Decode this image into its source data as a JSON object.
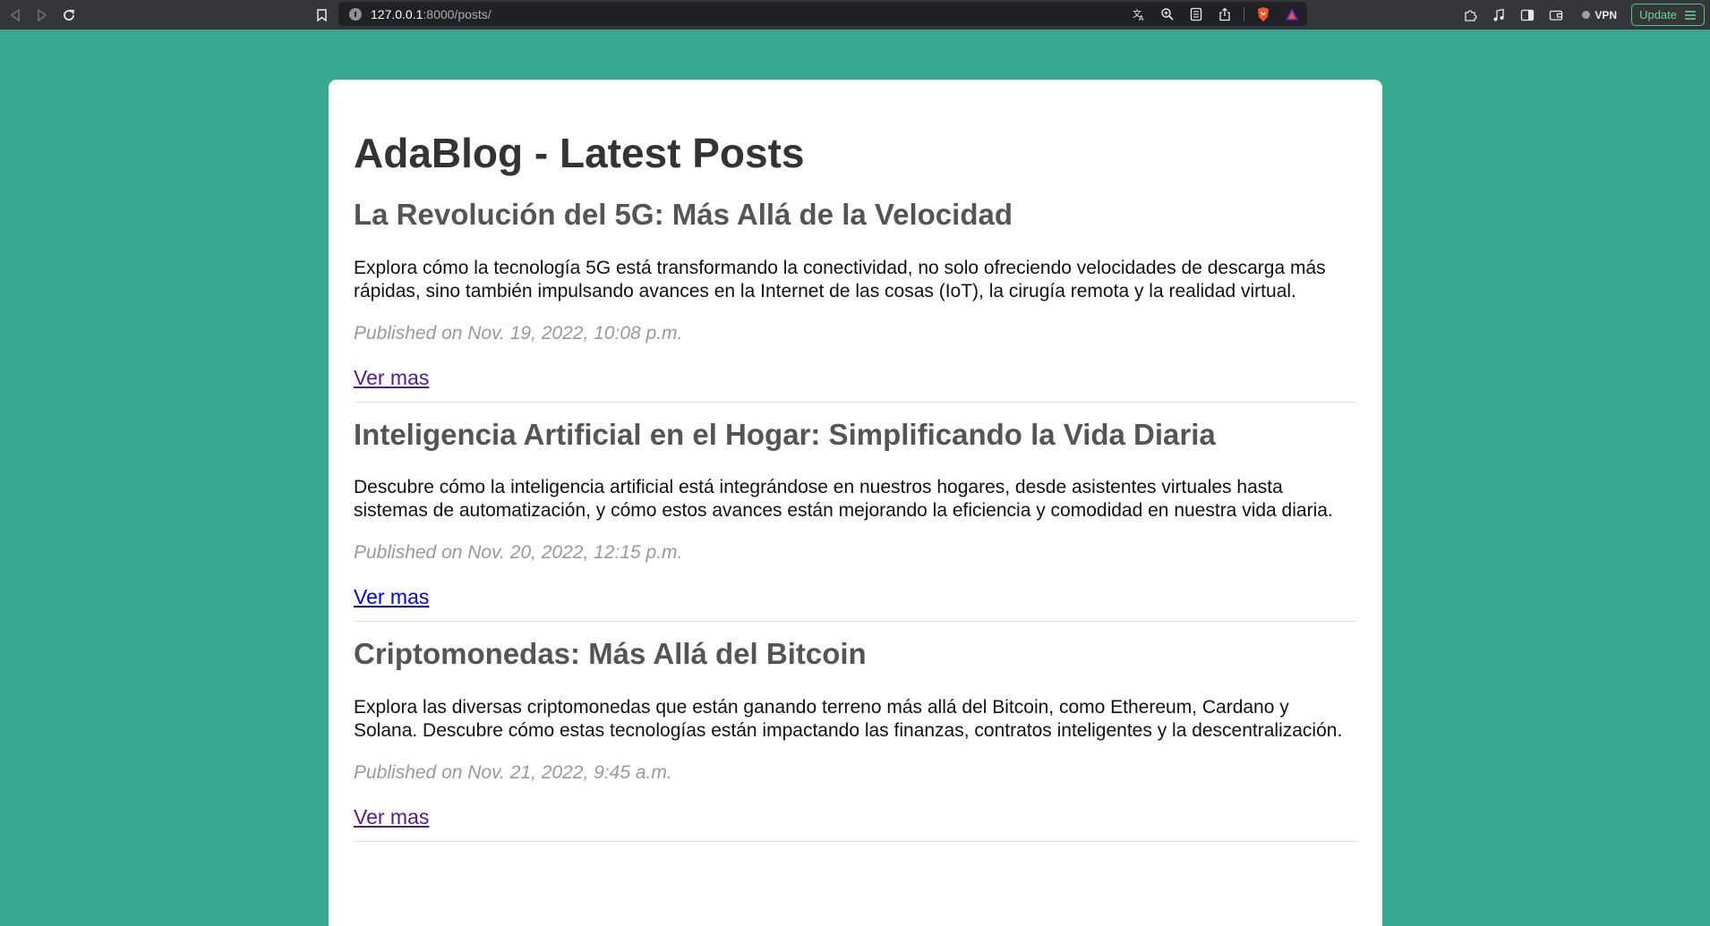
{
  "browser": {
    "url_host": "127.0.0.1",
    "url_rest": ":8000/posts/",
    "vpn_label": "VPN",
    "update_label": "Update",
    "accent": "#37a990"
  },
  "page": {
    "title": "AdaBlog - Latest Posts",
    "posts": [
      {
        "title": "La Revolución del 5G: Más Allá de la Velocidad",
        "excerpt": "Explora cómo la tecnología 5G está transformando la conectividad, no solo ofreciendo velocidades de descarga más rápidas, sino también impulsando avances en la Internet de las cosas (IoT), la cirugía remota y la realidad virtual.",
        "date": "Published on Nov. 19, 2022, 10:08 p.m.",
        "link": "Ver mas"
      },
      {
        "title": "Inteligencia Artificial en el Hogar: Simplificando la Vida Diaria",
        "excerpt": "Descubre cómo la inteligencia artificial está integrándose en nuestros hogares, desde asistentes virtuales hasta sistemas de automatización, y cómo estos avances están mejorando la eficiencia y comodidad en nuestra vida diaria.",
        "date": "Published on Nov. 20, 2022, 12:15 p.m.",
        "link": "Ver mas"
      },
      {
        "title": "Criptomonedas: Más Allá del Bitcoin",
        "excerpt": "Explora las diversas criptomonedas que están ganando terreno más allá del Bitcoin, como Ethereum, Cardano y Solana. Descubre cómo estas tecnologías están impactando las finanzas, contratos inteligentes y la descentralización.",
        "date": "Published on Nov. 21, 2022, 9:45 a.m.",
        "link": "Ver mas"
      }
    ]
  }
}
